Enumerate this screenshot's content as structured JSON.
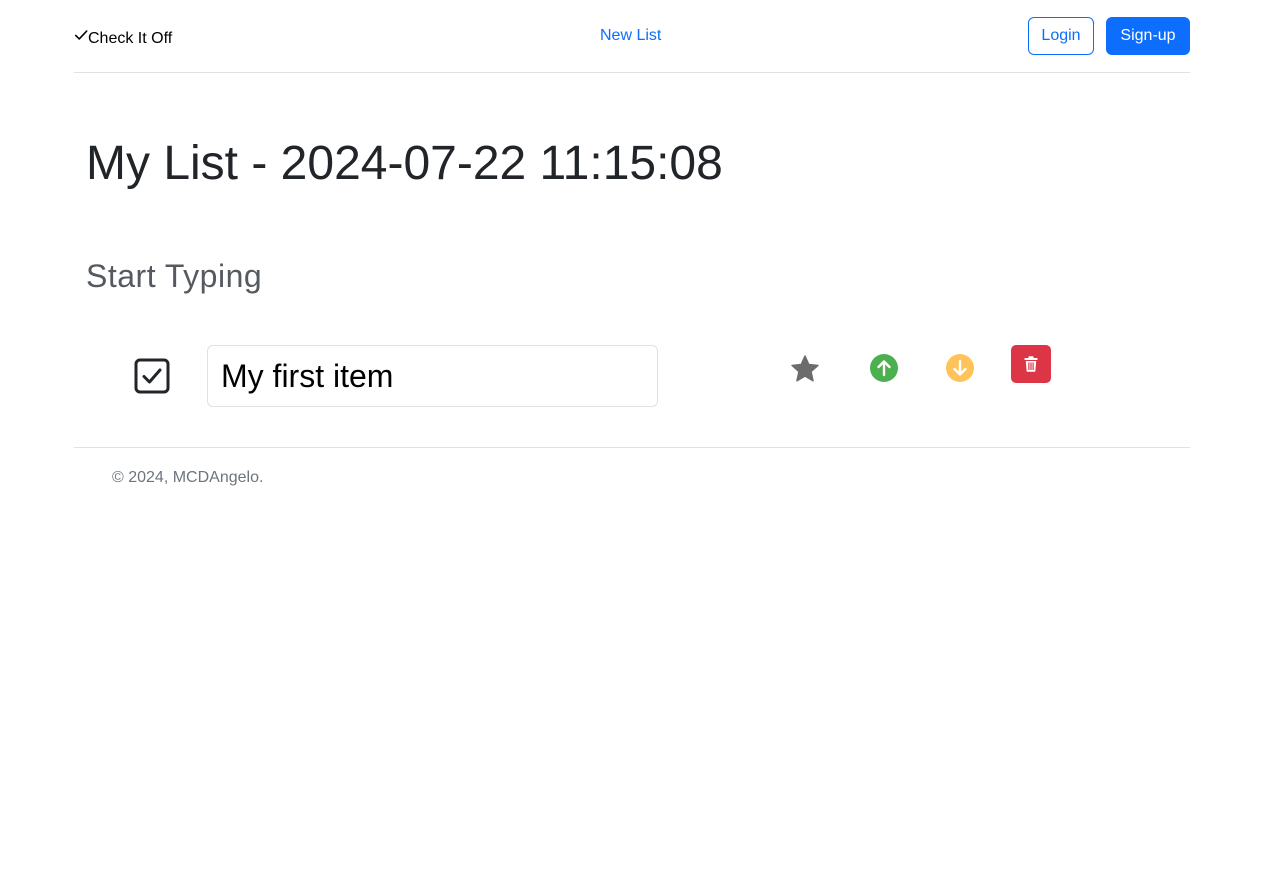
{
  "header": {
    "brand": "Check It Off",
    "new_list_label": "New List",
    "login_label": "Login",
    "signup_label": "Sign-up"
  },
  "main": {
    "title": "My List - 2024-07-22 11:15:08",
    "subtitle": "Start Typing",
    "items": [
      {
        "value": "My first item",
        "checked": true,
        "icons": [
          "check-square-icon",
          "star-icon",
          "arrow-up-circle-icon",
          "arrow-down-circle-icon",
          "trash-icon"
        ]
      }
    ]
  },
  "footer": {
    "text": "© 2024, MCDAngelo."
  },
  "colors": {
    "primary": "#0d6efd",
    "danger": "#dc3545",
    "success": "#4caf50",
    "warning": "#ffc35a",
    "star_gray": "#6c6c6c",
    "text": "#212529",
    "muted": "#6c757d"
  }
}
